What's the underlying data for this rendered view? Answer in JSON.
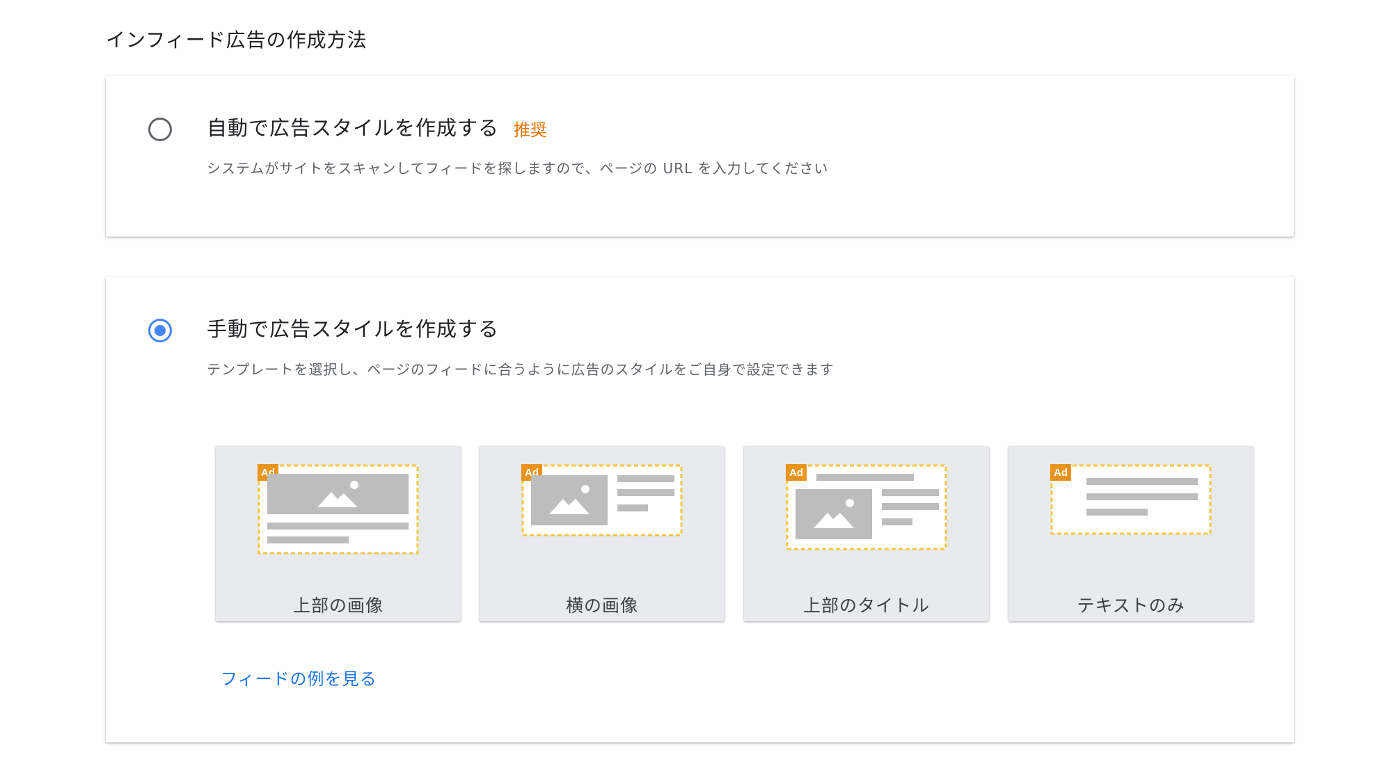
{
  "page": {
    "section_title": "インフィード広告の作成方法"
  },
  "options": {
    "auto": {
      "title": "自動で広告スタイルを作成する",
      "badge": "推奨",
      "description": "システムがサイトをスキャンしてフィードを探しますので、ページの URL を入力してください",
      "selected": false
    },
    "manual": {
      "title": "手動で広告スタイルを作成する",
      "description": "テンプレートを選択し、ページのフィードに合うように広告のスタイルをご自身で設定できます",
      "selected": true
    }
  },
  "templates": [
    {
      "label": "上部の画像",
      "ad_badge": "Ad",
      "icon": "image-top-icon"
    },
    {
      "label": "横の画像",
      "ad_badge": "Ad",
      "icon": "image-side-icon"
    },
    {
      "label": "上部のタイトル",
      "ad_badge": "Ad",
      "icon": "title-top-icon"
    },
    {
      "label": "テキストのみ",
      "ad_badge": "Ad",
      "icon": "text-only-icon"
    }
  ],
  "links": {
    "feed_example": "フィードの例を見る"
  },
  "colors": {
    "accent_blue": "#4285f4",
    "link_blue": "#1a73e8",
    "recommend_orange": "#e37400",
    "ad_badge_orange": "#e8941e",
    "dash_yellow": "#f4c542",
    "placeholder_gray": "#bdbdbd",
    "tile_bg": "#e8eaed"
  }
}
